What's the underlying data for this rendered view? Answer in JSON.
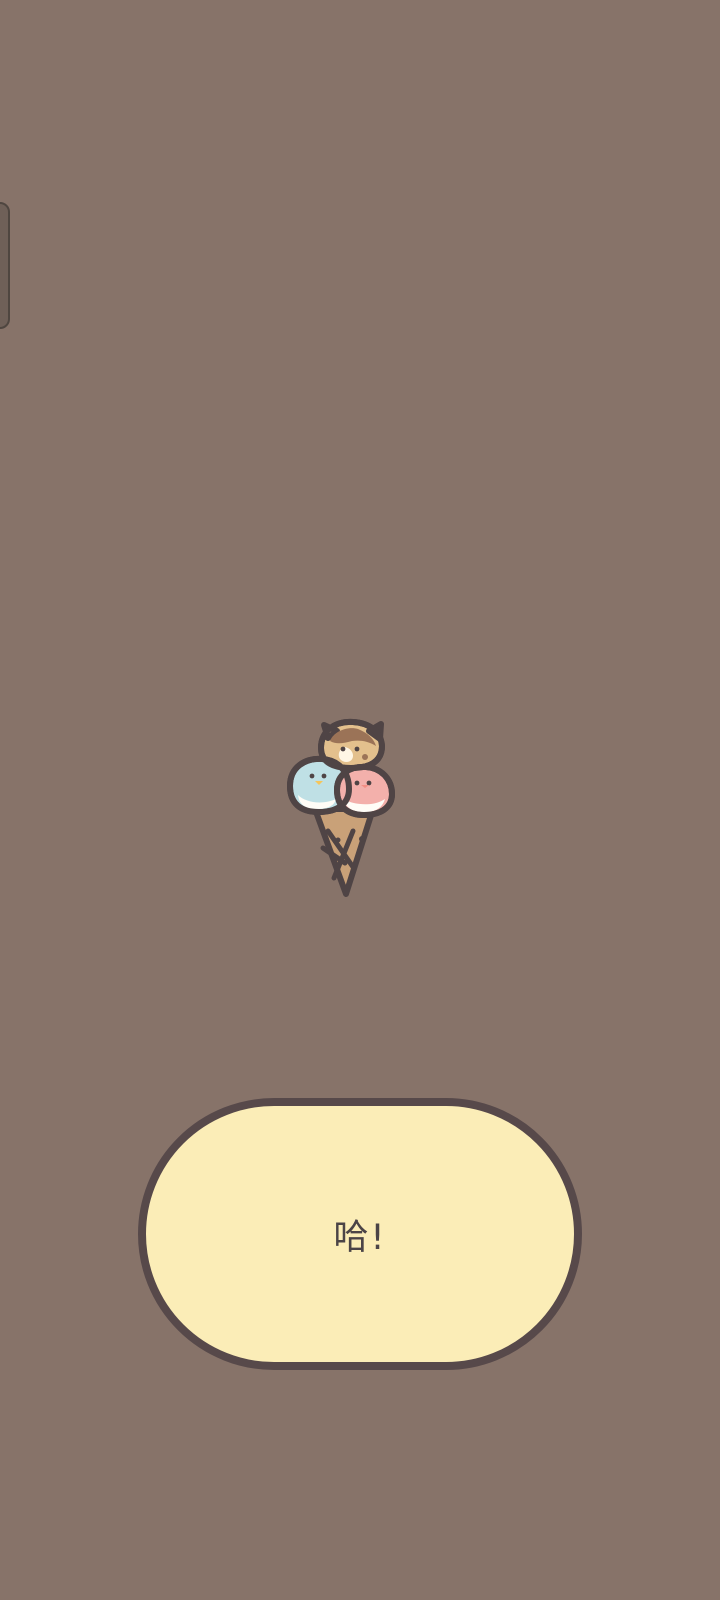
{
  "app": {
    "background_color": "#877369"
  },
  "side_handle": {
    "color": "#6f6058"
  },
  "mascot": {
    "icon": "ice-cream-cone-with-animal-scoops-icon"
  },
  "action_button": {
    "label": "哈!",
    "fill_color": "#fbedb7",
    "border_color": "#57494a",
    "text_color": "#4b4446"
  }
}
